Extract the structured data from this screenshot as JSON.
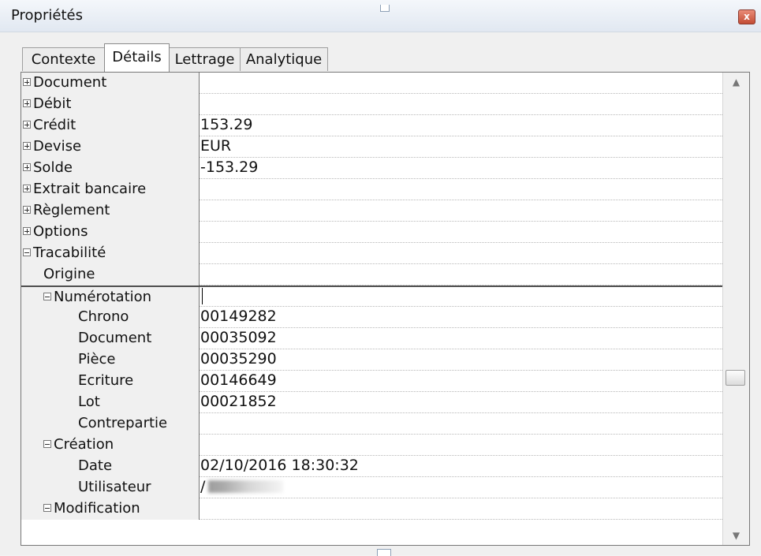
{
  "window": {
    "title": "Propriétés",
    "close_icon": "close-icon"
  },
  "tabs": [
    {
      "label": "Contexte",
      "active": false
    },
    {
      "label": "Détails",
      "active": true
    },
    {
      "label": "Lettrage",
      "active": false
    },
    {
      "label": "Analytique",
      "active": false
    }
  ],
  "properties": [
    {
      "name": "Document",
      "value": "",
      "level": 0,
      "expander": "plus"
    },
    {
      "name": "Débit",
      "value": "",
      "level": 0,
      "expander": "plus"
    },
    {
      "name": "Crédit",
      "value": "153.29",
      "level": 0,
      "expander": "plus"
    },
    {
      "name": "Devise",
      "value": "EUR",
      "level": 0,
      "expander": "plus"
    },
    {
      "name": "Solde",
      "value": "-153.29",
      "level": 0,
      "expander": "plus"
    },
    {
      "name": "Extrait bancaire",
      "value": "",
      "level": 0,
      "expander": "plus"
    },
    {
      "name": "Règlement",
      "value": "",
      "level": 0,
      "expander": "plus"
    },
    {
      "name": "Options",
      "value": "",
      "level": 0,
      "expander": "plus"
    },
    {
      "name": "Tracabilité",
      "value": "",
      "level": 0,
      "expander": "minus"
    },
    {
      "name": "Origine",
      "value": "",
      "level": 1,
      "expander": ""
    },
    {
      "name": "Numérotation",
      "value": "",
      "level": 1,
      "expander": "minus",
      "selected": true
    },
    {
      "name": "Chrono",
      "value": "00149282",
      "level": 2,
      "expander": ""
    },
    {
      "name": "Document",
      "value": "00035092",
      "level": 2,
      "expander": ""
    },
    {
      "name": "Pièce",
      "value": "00035290",
      "level": 2,
      "expander": ""
    },
    {
      "name": "Ecriture",
      "value": "00146649",
      "level": 2,
      "expander": ""
    },
    {
      "name": "Lot",
      "value": "00021852",
      "level": 2,
      "expander": ""
    },
    {
      "name": "Contrepartie",
      "value": "",
      "level": 2,
      "expander": ""
    },
    {
      "name": "Création",
      "value": "",
      "level": 1,
      "expander": "minus"
    },
    {
      "name": "Date",
      "value": "02/10/2016 18:30:32",
      "level": 2,
      "expander": ""
    },
    {
      "name": "Utilisateur",
      "value": "/",
      "level": 2,
      "expander": "",
      "redacted": true
    },
    {
      "name": "Modification",
      "value": "",
      "level": 1,
      "expander": "minus"
    }
  ],
  "scrollbar": {
    "up_icon": "chevron-up-icon",
    "down_icon": "chevron-down-icon"
  }
}
